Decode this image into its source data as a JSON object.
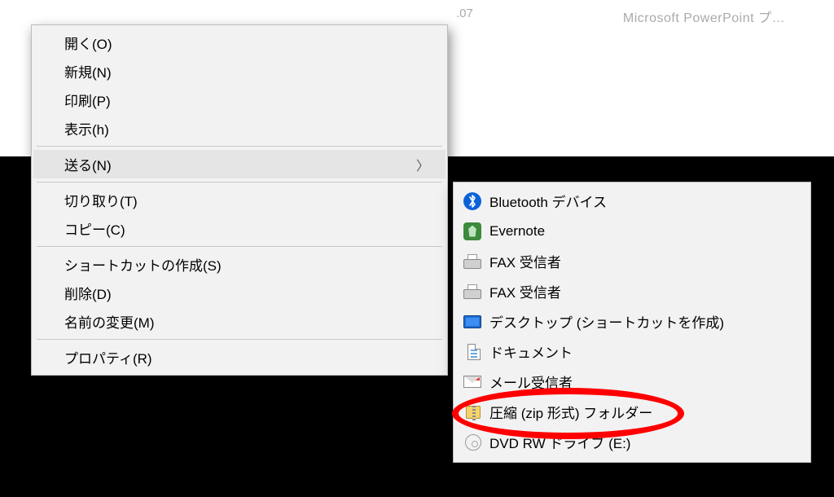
{
  "background": {
    "titlebar_text": "Microsoft PowerPoint プ…",
    "fragment_text": ".07"
  },
  "context_menu": {
    "groups": [
      [
        {
          "key": "open",
          "label": "開く(O)"
        },
        {
          "key": "new",
          "label": "新規(N)"
        },
        {
          "key": "print",
          "label": "印刷(P)"
        },
        {
          "key": "view",
          "label": "表示(h)"
        }
      ],
      [
        {
          "key": "send-to",
          "label": "送る(N)",
          "submenu": true,
          "hover": true
        }
      ],
      [
        {
          "key": "cut",
          "label": "切り取り(T)"
        },
        {
          "key": "copy",
          "label": "コピー(C)"
        }
      ],
      [
        {
          "key": "create-shortcut",
          "label": "ショートカットの作成(S)"
        },
        {
          "key": "delete",
          "label": "削除(D)"
        },
        {
          "key": "rename",
          "label": "名前の変更(M)"
        }
      ],
      [
        {
          "key": "properties",
          "label": "プロパティ(R)"
        }
      ]
    ]
  },
  "submenu": {
    "items": [
      {
        "key": "bluetooth",
        "icon": "bluetooth-icon",
        "label": "Bluetooth デバイス"
      },
      {
        "key": "evernote",
        "icon": "evernote-icon",
        "label": "Evernote"
      },
      {
        "key": "fax-1",
        "icon": "fax-icon",
        "label": "FAX 受信者"
      },
      {
        "key": "fax-2",
        "icon": "fax-icon",
        "label": "FAX 受信者"
      },
      {
        "key": "desktop",
        "icon": "desktop-icon",
        "label": "デスクトップ (ショートカットを作成)"
      },
      {
        "key": "documents",
        "icon": "document-icon",
        "label": "ドキュメント"
      },
      {
        "key": "mail",
        "icon": "mail-icon",
        "label": "メール受信者"
      },
      {
        "key": "zip",
        "icon": "zip-folder-icon",
        "label": "圧縮 (zip 形式) フォルダー",
        "highlighted": true
      },
      {
        "key": "dvd",
        "icon": "dvd-drive-icon",
        "label": "DVD RW ドライブ (E:)"
      }
    ]
  },
  "annotation": {
    "highlight_target": "zip"
  }
}
